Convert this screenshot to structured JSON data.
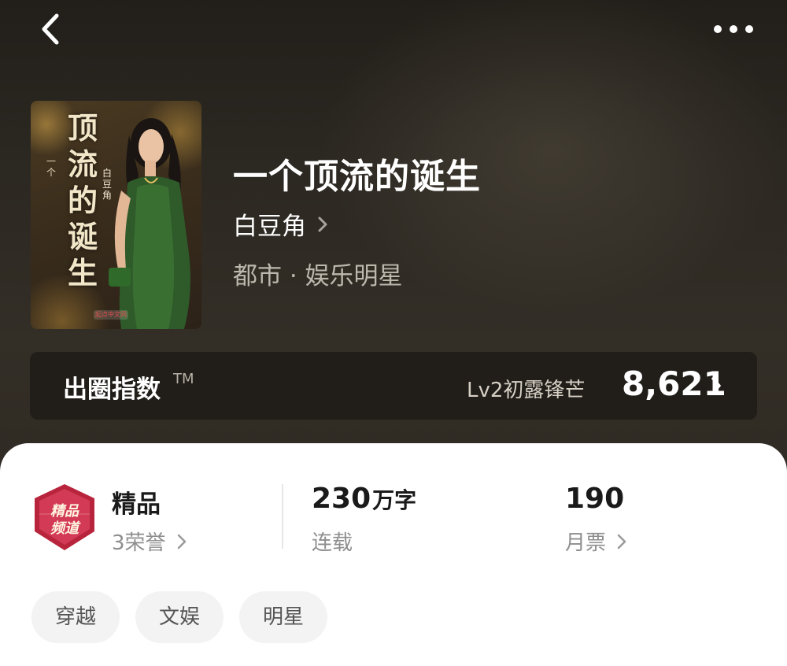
{
  "header": {
    "back_icon": "chevron-left-icon",
    "more_icon": "more-dots-icon"
  },
  "cover": {
    "title_text": "顶流的诞生",
    "sub_text": "一个",
    "author_text": "白豆角",
    "badge_text": "起点中文网"
  },
  "book": {
    "title": "一个顶流的诞生",
    "author": "白豆角",
    "genre": "都市 · 娱乐明星"
  },
  "index_bar": {
    "label": "出圈指数",
    "tm": "TM",
    "level": "Lv2初露锋芒",
    "value": "8,621"
  },
  "stats": {
    "badge_text": "精品频道",
    "quality_title": "精品",
    "honors": "3荣誉",
    "word_count": "230",
    "word_unit": "万字",
    "status": "连载",
    "monthly_tickets": "190",
    "monthly_tickets_label": "月票"
  },
  "tags": [
    "穿越",
    "文娱",
    "明星"
  ],
  "colors": {
    "hero_bg": "#2c2822",
    "card_bg": "#ffffff",
    "tag_bg": "#f3f3f3",
    "badge_red": "#b8243c"
  }
}
